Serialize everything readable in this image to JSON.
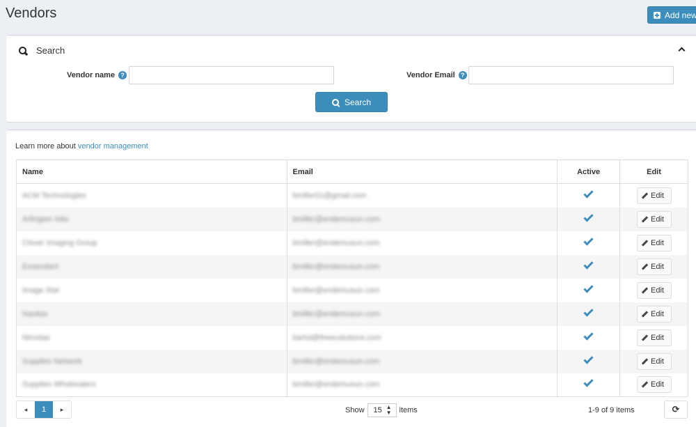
{
  "header": {
    "title": "Vendors",
    "add_new_label": "Add new"
  },
  "search_panel": {
    "title": "Search",
    "vendor_name_label": "Vendor name",
    "vendor_name_value": "",
    "vendor_email_label": "Vendor Email",
    "vendor_email_value": "",
    "search_button_label": "Search",
    "help_glyph": "?"
  },
  "grid": {
    "learn_more_text": "Learn more about ",
    "learn_more_link": "vendor management",
    "columns": {
      "name": "Name",
      "email": "Email",
      "active": "Active",
      "edit": "Edit"
    },
    "rows": [
      {
        "name": "ACM Technologies",
        "email": "bmiller01@gmail.com",
        "active": true,
        "edit_label": "Edit"
      },
      {
        "name": "Arlington Inks",
        "email": "bmiller@endemusun.com",
        "active": true,
        "edit_label": "Edit"
      },
      {
        "name": "Clover Imaging Group",
        "email": "bmiller@endemusun.com",
        "active": true,
        "edit_label": "Edit"
      },
      {
        "name": "Essendant",
        "email": "bmiller@endemusun.com",
        "active": true,
        "edit_label": "Edit"
      },
      {
        "name": "Image Star",
        "email": "bmiller@endemusun.com",
        "active": true,
        "edit_label": "Edit"
      },
      {
        "name": "Navitas",
        "email": "bmiller@endemusun.com",
        "active": true,
        "edit_label": "Edit"
      },
      {
        "name": "Nirvolas",
        "email": "bartol@theeuslutions.com",
        "active": true,
        "edit_label": "Edit"
      },
      {
        "name": "Supplies Network",
        "email": "bmiller@endemusun.com",
        "active": true,
        "edit_label": "Edit"
      },
      {
        "name": "Supplies Wholesalers",
        "email": "bmiller@endemusun.com",
        "active": true,
        "edit_label": "Edit"
      }
    ]
  },
  "pagination": {
    "prev_glyph": "◂",
    "current_page": "1",
    "next_glyph": "▸",
    "show_label": "Show",
    "page_size": "15",
    "items_label": "items",
    "range_text": "1-9 of 9 items",
    "refresh_glyph": "⟳"
  },
  "colors": {
    "accent": "#3c8dbc",
    "background": "#ecf0f5"
  }
}
